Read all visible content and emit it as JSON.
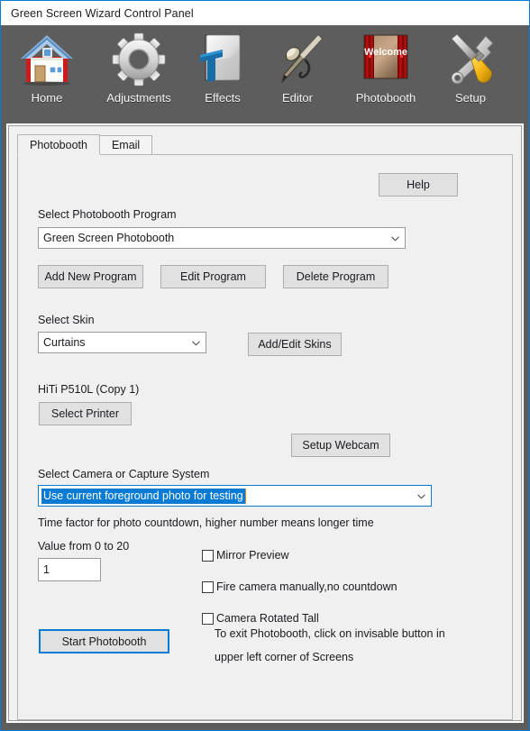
{
  "window": {
    "title": "Green Screen Wizard Control Panel",
    "accent_color": "#0a7bd4",
    "toolbar_bg": "#5d5d5d",
    "client_bg": "#f0f0f0"
  },
  "toolbar": {
    "items": [
      {
        "label": "Home",
        "icon": "house-icon"
      },
      {
        "label": "Adjustments",
        "icon": "gear-icon"
      },
      {
        "label": "Effects",
        "icon": "text-effects-icon"
      },
      {
        "label": "Editor",
        "icon": "airbrush-pen-icon"
      },
      {
        "label": "Photobooth",
        "icon": "welcome-curtain-icon"
      },
      {
        "label": "Setup",
        "icon": "wrench-screwdriver-icon"
      }
    ],
    "photobooth_icon_text": "Welcome"
  },
  "tabs": [
    {
      "label": "Photobooth",
      "active": true
    },
    {
      "label": "Email",
      "active": false
    }
  ],
  "page": {
    "help_button": "Help",
    "program_label": "Select Photobooth Program",
    "program_value": "Green Screen Photobooth",
    "add_new_program": "Add New Program",
    "edit_program": "Edit Program",
    "delete_program": "Delete Program",
    "skin_label": "Select Skin",
    "skin_value": "Curtains",
    "add_edit_skins": "Add/Edit Skins",
    "printer_name": "HiTi P510L (Copy 1)",
    "select_printer": "Select Printer",
    "setup_webcam": "Setup Webcam",
    "camera_label": "Select Camera or Capture System",
    "camera_value": "Use current foreground photo for testing",
    "time_factor_label": "Time factor for photo countdown, higher number means longer time",
    "value_range_label": "Value from 0  to 20",
    "time_factor_value": "1",
    "checkboxes": [
      {
        "label": "Mirror Preview",
        "checked": false
      },
      {
        "label": "Fire camera manually,no countdown",
        "checked": false
      },
      {
        "label": "Camera Rotated Tall",
        "checked": false
      }
    ],
    "start_button": "Start Photobooth",
    "exit_note_line1": "To exit Photobooth, click on invisable button in",
    "exit_note_line2": "upper left corner of  Screens"
  }
}
